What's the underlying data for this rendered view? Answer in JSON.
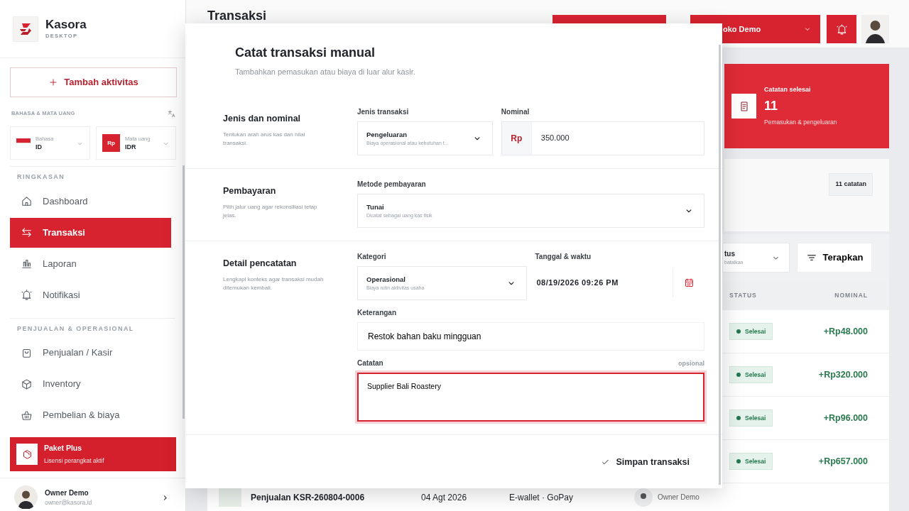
{
  "sidebar": {
    "brand": {
      "name": "Kasora",
      "subtitle": "DESKTOP"
    },
    "add_button": "Tambah aktivitas",
    "locale": {
      "label": "BAHASA & MATA UANG",
      "language": {
        "caption": "Bahasa",
        "value": "ID"
      },
      "currency": {
        "badge": "Rp",
        "caption": "Mata uang",
        "value": "IDR"
      }
    },
    "sections": [
      {
        "title": "RINGKASAN",
        "items": [
          {
            "label": "Dashboard",
            "selected": false
          },
          {
            "label": "Transaksi",
            "selected": true
          },
          {
            "label": "Laporan",
            "selected": false
          },
          {
            "label": "Notifikasi",
            "selected": false
          }
        ]
      },
      {
        "title": "PENJUALAN & OPERASIONAL",
        "items": [
          {
            "label": "Penjualan / Kasir",
            "selected": false
          },
          {
            "label": "Inventory",
            "selected": false
          },
          {
            "label": "Pembelian & biaya",
            "selected": false
          }
        ]
      }
    ],
    "plan": {
      "title": "Paket Plus",
      "subtitle": "Lisensi perangkat aktif"
    },
    "user": {
      "name": "Owner Demo",
      "email": "owner@kasora.id"
    }
  },
  "header": {
    "title": "Transaksi",
    "store": "oko Demo"
  },
  "summary_card": {
    "title": "Catatan selesai",
    "value": "11",
    "caption": "Pemasukan & pengeluaran"
  },
  "records_panel": {
    "count": "11 catatan"
  },
  "filters": {
    "status_label": "tus",
    "status_hint": "batalkan",
    "apply_button": "Terapkan"
  },
  "table": {
    "columns": [
      "STATUS",
      "NOMINAL"
    ],
    "rows": [
      {
        "status": "Selesai",
        "nominal": "+Rp48.000"
      },
      {
        "status": "Selesai",
        "nominal": "+Rp320.000"
      },
      {
        "status": "Selesai",
        "nominal": "+Rp96.000"
      },
      {
        "status": "Selesai",
        "nominal": "+Rp657.000"
      }
    ],
    "partial_row": {
      "title": "Penjualan KSR-260804-0006",
      "date": "04 Agt 2026",
      "method": "E-wallet · GoPay",
      "owner": "Owner Demo"
    }
  },
  "modal": {
    "title": "Catat transaksi manual",
    "subtitle": "Tambahkan pemasukan atau biaya di luar alur kasir.",
    "sections": [
      {
        "title": "Jenis dan nominal",
        "description": "Tentukan arah arus kas dan nilai transaksi.",
        "fields": [
          {
            "kind": "select",
            "label": "Jenis transaksi",
            "value": "Pengeluaran",
            "hint": "Biaya operasional atau kebutuhan t...",
            "focused": false
          },
          {
            "kind": "amount",
            "label": "Nominal",
            "prefix": "Rp",
            "value": "350.000",
            "focused": false
          }
        ]
      },
      {
        "title": "Pembayaran",
        "description": "Pilih jalur uang agar rekonsiliasi tetap jelas.",
        "fields": [
          {
            "kind": "select",
            "label": "Metode pembayaran",
            "value": "Tunai",
            "hint": "Dicatat sebagai uang kas fisik",
            "focused": false
          }
        ]
      },
      {
        "title": "Detail pencatatan",
        "description": "Lengkapi konteks agar transaksi mudah ditemukan kembali.",
        "fields": [
          {
            "kind": "select",
            "label": "Kategori",
            "value": "Operasional",
            "hint": "Biaya rutin aktivitas usaha",
            "focused": false
          },
          {
            "kind": "datetime",
            "label": "Tanggal & waktu",
            "value": "08/19/2026 09:26 PM",
            "focused": false
          },
          {
            "kind": "text",
            "label": "Keterangan",
            "value": "Restok bahan baku mingguan",
            "focused": false
          },
          {
            "kind": "textarea",
            "label": "Catatan",
            "note": "opsional",
            "value": "Supplier Bali Roastery",
            "focused": true
          }
        ]
      }
    ],
    "submit": "Simpan transaksi"
  }
}
